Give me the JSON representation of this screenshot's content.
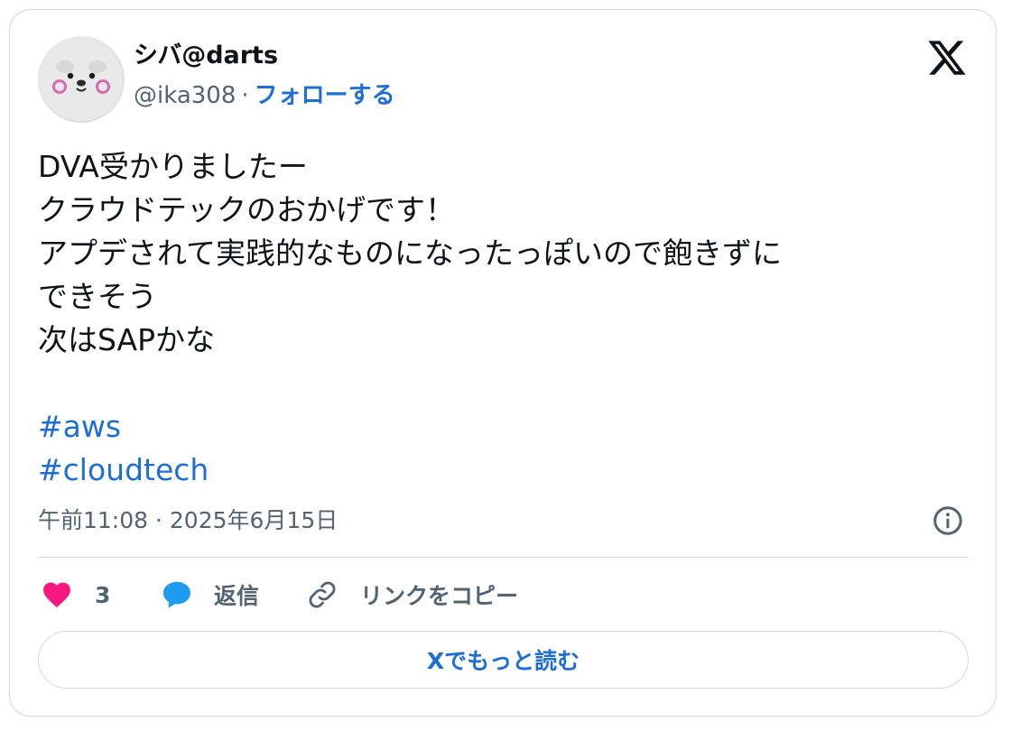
{
  "user": {
    "display_name": "シバ@darts",
    "handle": "@ika308",
    "separator": "·",
    "follow_label": "フォローする",
    "avatar_icon": "plush-dog-face-avatar"
  },
  "brand": {
    "logo_icon": "x-logo-icon"
  },
  "tweet": {
    "lines": [
      "DVA受かりましたー",
      "クラウドテックのおかげです！",
      "アプデされて実践的なものになったっぽいので飽きずに",
      "できそう",
      "次はSAPかな"
    ],
    "hashtags": [
      "#aws",
      "#cloudtech"
    ],
    "timestamp": "午前11:08 · 2025年6月15日"
  },
  "actions": {
    "like_count": "3",
    "reply_label": "返信",
    "copy_link_label": "リンクをコピー"
  },
  "read_more_label": "Xでもっと読む",
  "colors": {
    "accent": "#1d6fd6",
    "like": "#f91880",
    "reply": "#1d9bf0",
    "secondary_text": "#536471",
    "border": "#cfd9de"
  }
}
